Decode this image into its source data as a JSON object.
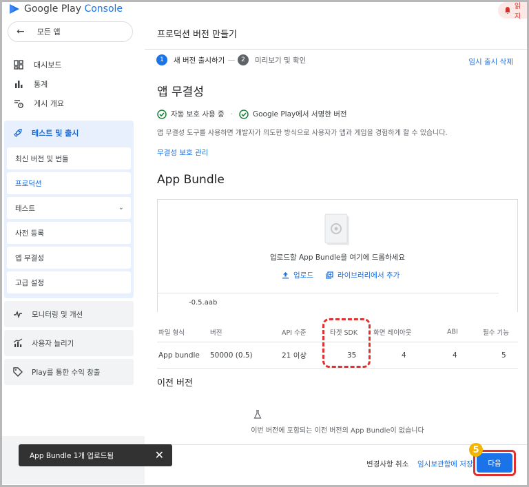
{
  "header": {
    "logo_google_play": "Google Play",
    "logo_console": "Console",
    "notification_text": "읽지"
  },
  "sidebar": {
    "back_label": "모든 앱",
    "items": [
      {
        "label": "대시보드",
        "icon": "dashboard-icon"
      },
      {
        "label": "통계",
        "icon": "bar-chart-icon"
      },
      {
        "label": "게시 개요",
        "icon": "publish-overview-icon"
      }
    ],
    "section_label": "테스트 및 출시",
    "subitems": [
      "최신 버전 및 번들",
      "프로덕션",
      "테스트",
      "사전 등록",
      "앱 무결성",
      "고급 설정"
    ],
    "groups": [
      "모니터링 및 개선",
      "사용자 늘리기",
      "Play를 통한 수익 창출"
    ]
  },
  "main": {
    "page_title": "프로덕션 버전 만들기",
    "steps": [
      {
        "num": "1",
        "label": "새 버전 출시하기"
      },
      {
        "num": "2",
        "label": "미리보기 및 확인"
      }
    ],
    "discard_draft": "임시 출시 삭제",
    "integrity": {
      "title": "앱 무결성",
      "check1": "자동 보호 사용 중",
      "check2": "Google Play에서 서명한 버전",
      "description": "앱 무결성 도구를 사용하면 개발자가 의도한 방식으로 사용자가 앱과 게임을 경험하게 할 수 있습니다.",
      "manage_link": "무결성 보호 관리"
    },
    "bundle": {
      "title": "App Bundle",
      "drop_text": "업로드할 App Bundle을 여기에 드롭하세요",
      "upload": "업로드",
      "add_from_library": "라이브러리에서 추가",
      "file_name": "-0.5.aab"
    },
    "table": {
      "headers": [
        "파일 형식",
        "버전",
        "API 수준",
        "타겟 SDK",
        "화면 레이아웃",
        "ABI",
        "필수 기능"
      ],
      "row": [
        "App bundle",
        "50000 (0.5)",
        "21 이상",
        "35",
        "4",
        "4",
        "5"
      ]
    },
    "previous": {
      "title": "이전 버전",
      "empty": "이번 버전에 포함되는 이전 버전의 App Bundle이 없습니다"
    }
  },
  "footer": {
    "cancel": "변경사항 취소",
    "save_draft": "임시보관함에 저장",
    "next": "다음",
    "step_badge": "5"
  },
  "toast": {
    "message": "App Bundle 1개 업로드됨"
  }
}
